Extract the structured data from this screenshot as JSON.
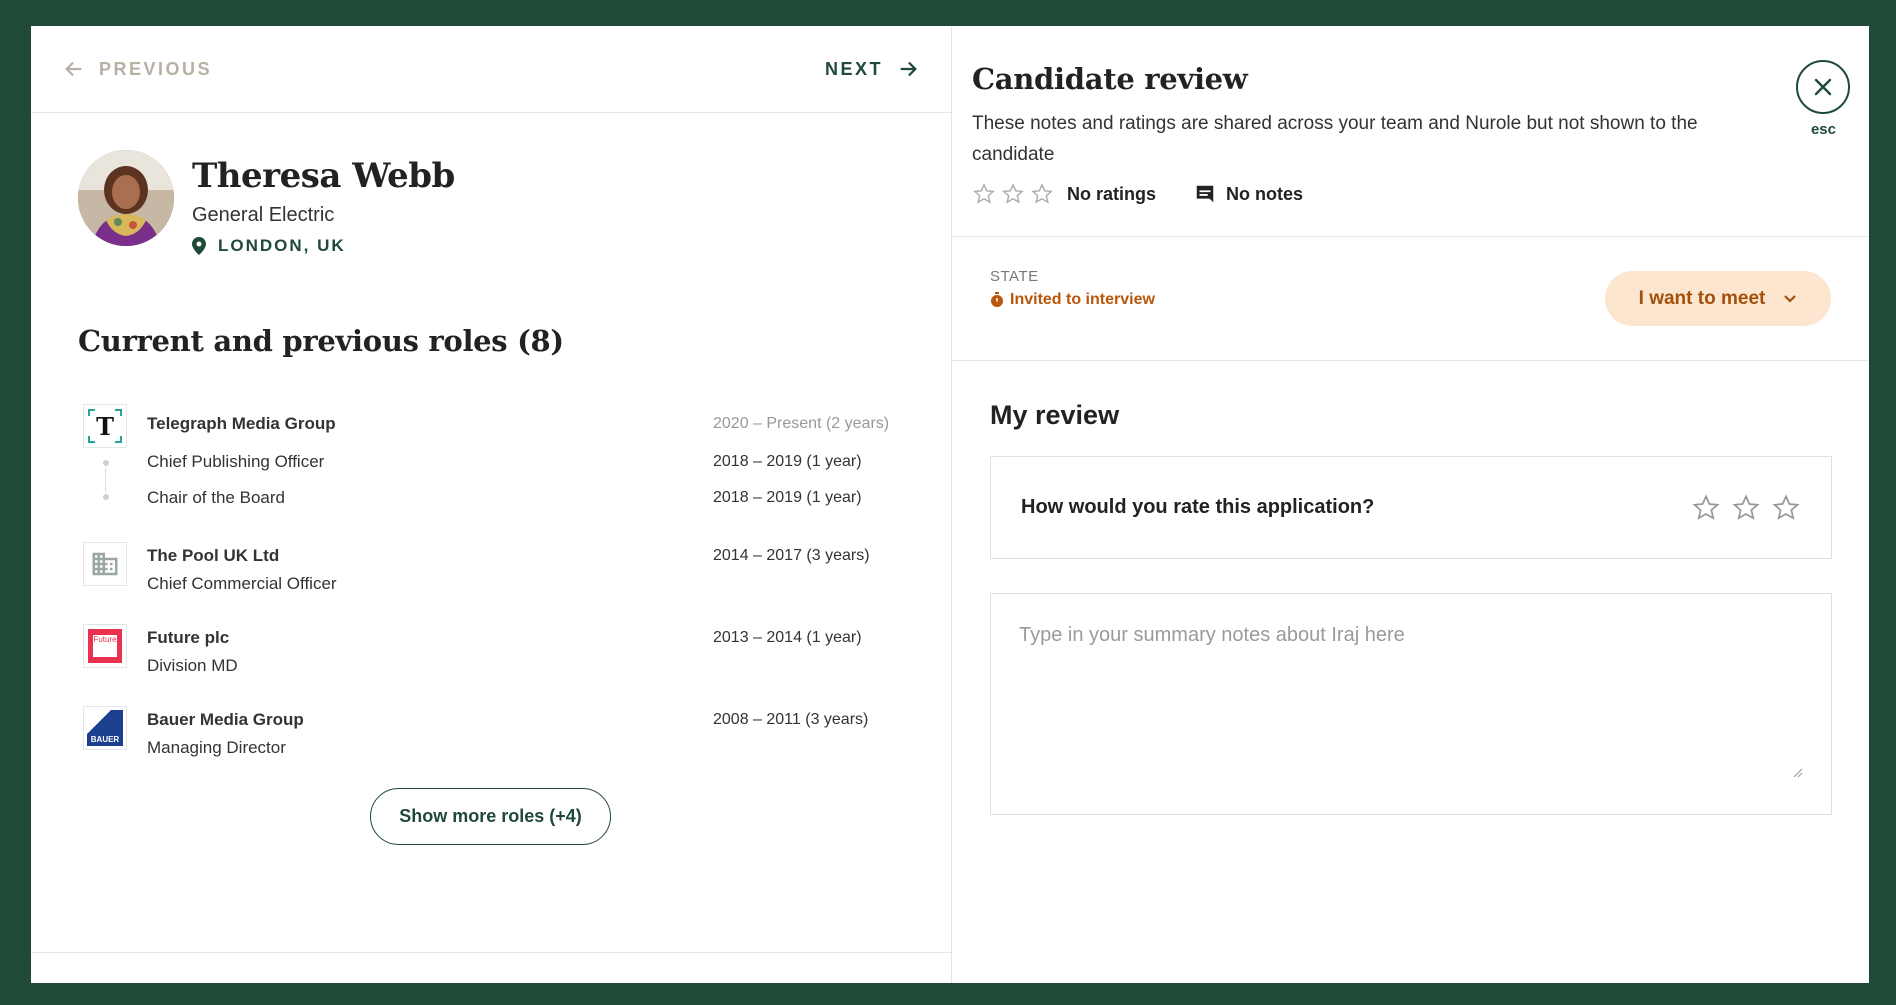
{
  "nav": {
    "previous_label": "PREVIOUS",
    "next_label": "NEXT"
  },
  "profile": {
    "name": "Theresa Webb",
    "company": "General Electric",
    "location": "LONDON, UK"
  },
  "roles_section": {
    "title": "Current and previous roles (8)",
    "groups": [
      {
        "company": "Telegraph Media Group",
        "company_dates": "2020 – Present (2 years)",
        "logo": "telegraph-logo",
        "roles": [
          {
            "title": "Chief Publishing Officer",
            "dates": "2018 – 2019 (1 year)"
          },
          {
            "title": "Chair of the Board",
            "dates": "2018 – 2019 (1 year)"
          }
        ]
      },
      {
        "company": "The Pool UK Ltd",
        "company_dates": "2014 – 2017 (3 years)",
        "logo": "building-icon",
        "roles": [
          {
            "title": "Chief Commercial Officer"
          }
        ]
      },
      {
        "company": "Future plc",
        "company_dates": "2013 – 2014 (1 year)",
        "logo": "future-logo",
        "logo_text": "Future",
        "roles": [
          {
            "title": "Division MD"
          }
        ]
      },
      {
        "company": "Bauer Media Group",
        "company_dates": "2008 – 2011 (3 years)",
        "logo": "bauer-logo",
        "logo_text": "BAUER",
        "roles": [
          {
            "title": "Managing Director"
          }
        ]
      }
    ],
    "show_more_label": "Show more roles (+4)"
  },
  "review": {
    "title": "Candidate review",
    "description": "These notes and ratings are shared across your team and Nurole but not shown to the candidate",
    "ratings_label": "No ratings",
    "notes_label": "No notes",
    "close_hint": "esc"
  },
  "state": {
    "label": "STATE",
    "value": "Invited to interview",
    "action_label": "I want to meet"
  },
  "my_review": {
    "title": "My review",
    "rating_question": "How would you rate this application?",
    "rating": 0,
    "notes_placeholder": "Type in your summary notes about Iraj here"
  },
  "colors": {
    "brand": "#1f4a37",
    "state": "#b8560b",
    "action_bg": "#fde6cf"
  }
}
